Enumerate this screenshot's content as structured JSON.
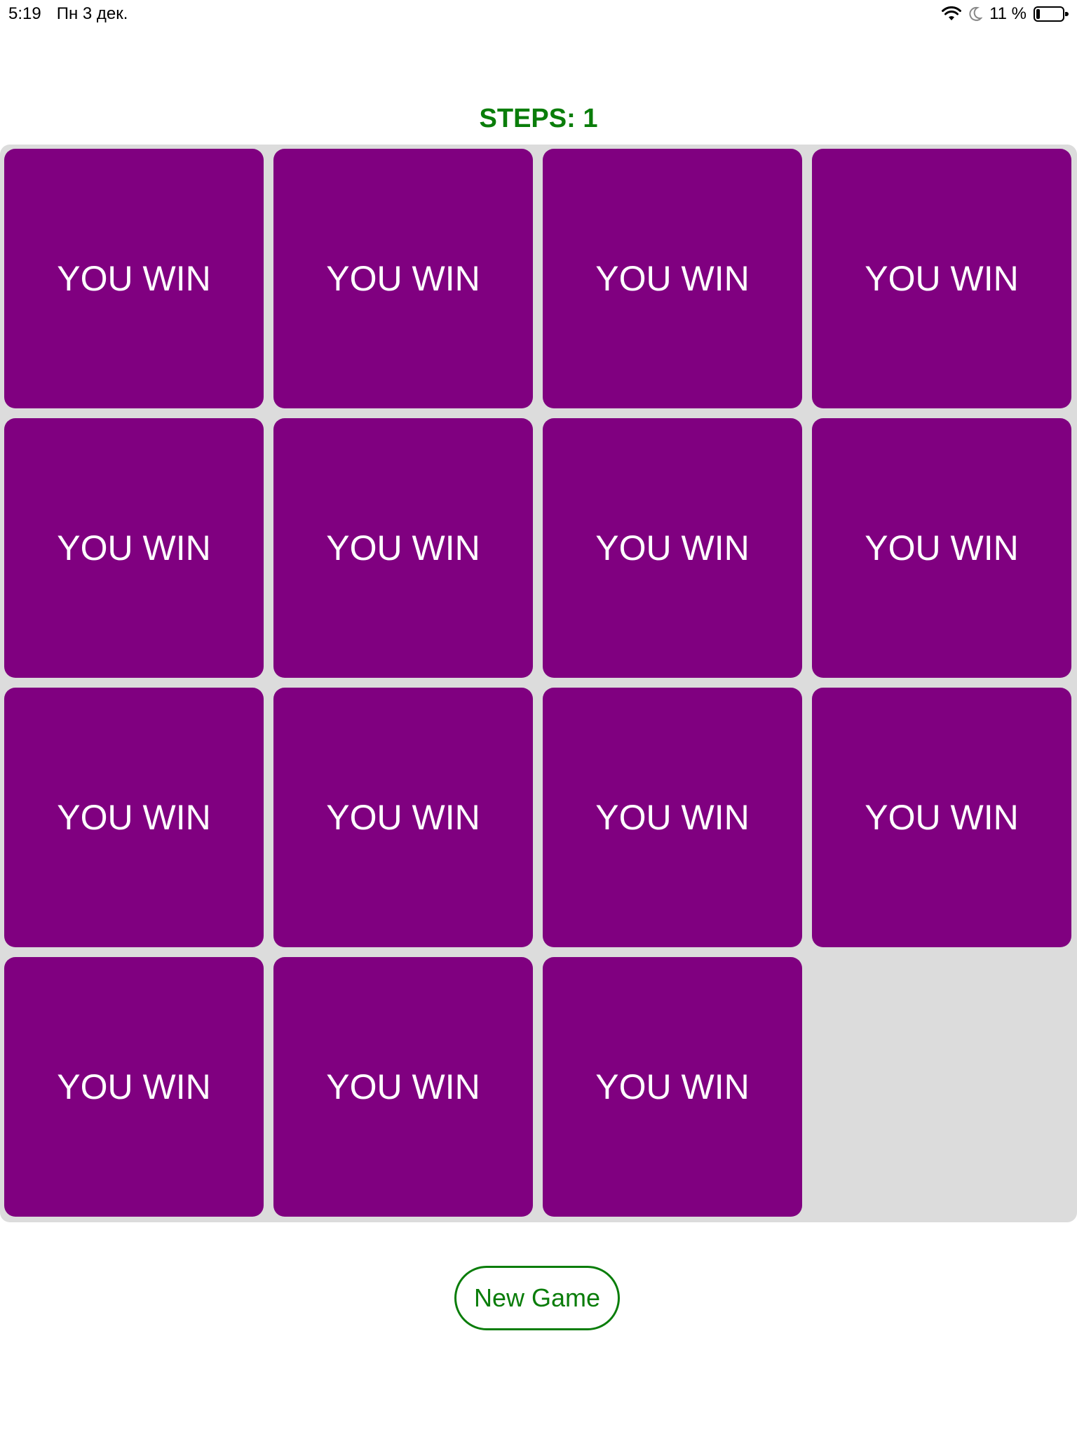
{
  "status_bar": {
    "time": "5:19",
    "date": "Пн 3 дек.",
    "battery": "11 %"
  },
  "game": {
    "steps_label": "STEPS: 1",
    "tiles": [
      "YOU WIN",
      "YOU WIN",
      "YOU WIN",
      "YOU WIN",
      "YOU WIN",
      "YOU WIN",
      "YOU WIN",
      "YOU WIN",
      "YOU WIN",
      "YOU WIN",
      "YOU WIN",
      "YOU WIN",
      "YOU WIN",
      "YOU WIN",
      "YOU WIN"
    ],
    "new_game_label": "New Game"
  },
  "colors": {
    "tile": "#800080",
    "board": "#dcdcdc",
    "accent": "#0a7d0a"
  }
}
